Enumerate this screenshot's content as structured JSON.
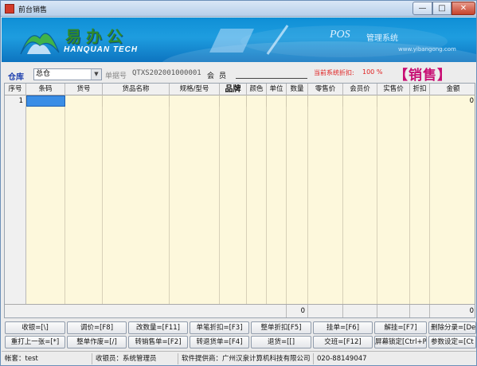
{
  "window": {
    "title": "前台销售",
    "controls": {
      "minimize": "—",
      "maximize": "□",
      "close": "✕"
    }
  },
  "banner": {
    "logo_text": "易办公",
    "logo_sub": "HANQUAN TECH",
    "product": "POS",
    "product_suffix": "管理系统",
    "url": "www.yibangong.com"
  },
  "info": {
    "warehouse_label": "仓库",
    "warehouse_value": "总仓",
    "bill_label": "单据号",
    "bill_no": "QTXS202001000001",
    "member_label": "会员",
    "discount_label": "当前系统折扣:",
    "discount_value": "100 %",
    "mode_title": "【销售】"
  },
  "table": {
    "columns": [
      "序号",
      "条码",
      "货号",
      "货品名称",
      "规格/型号",
      "品牌",
      "颜色",
      "单位",
      "数量",
      "零售价",
      "会员价",
      "实售价",
      "折扣",
      "金额"
    ],
    "rows": [
      {
        "seq": "1",
        "barcode": "",
        "item_no": "",
        "name": "",
        "spec": "",
        "brand": "",
        "color": "",
        "unit": "",
        "qty": "",
        "retail": "",
        "member_price": "",
        "actual": "",
        "discount": "",
        "amount": "0"
      }
    ],
    "footer": {
      "qty_total": "0",
      "amount_total": "0"
    }
  },
  "buttons": {
    "row1": [
      "收银=[\\]",
      "调价=[F8]",
      "改数量=[F11]",
      "单笔折扣=[F3]",
      "整单折扣[F5]",
      "挂单=[F6]",
      "解挂=[F7]",
      "删除分录=[De"
    ],
    "row2": [
      "重打上一张=[*]",
      "整单作废=[/]",
      "转销售单=[F2]",
      "转退货单=[F4]",
      "退货=[[]",
      "交班=[F12]",
      "屏幕锁定[Ctrl+P]",
      "参数设定=[Ct"
    ]
  },
  "status": {
    "account": "帐套：test",
    "cashier": "收银员：系统管理员",
    "provider": "软件提供商：广州汉泉计算机科技有限公司",
    "phone": "020-88149047"
  }
}
